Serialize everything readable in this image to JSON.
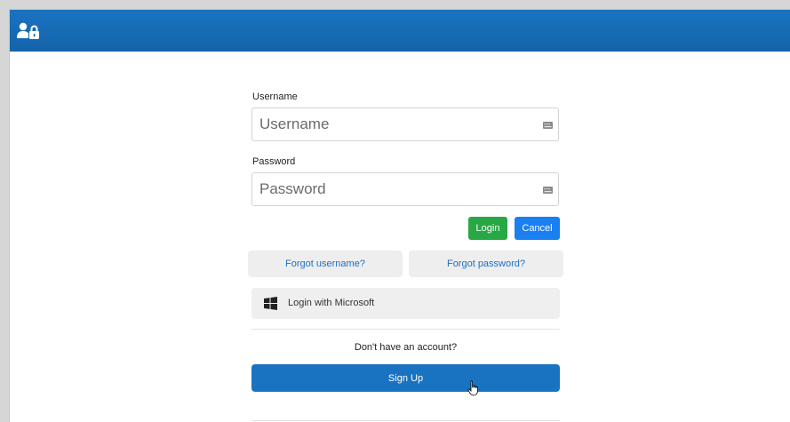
{
  "header": {
    "logo_icon": "user-lock-icon",
    "color": "#1a73c1"
  },
  "form": {
    "username_label": "Username",
    "username_placeholder": "Username",
    "username_value": "",
    "password_label": "Password",
    "password_placeholder": "Password",
    "password_value": "",
    "field_icon": "keyboard-icon",
    "login_label": "Login",
    "cancel_label": "Cancel",
    "forgot_username_label": "Forgot username?",
    "forgot_password_label": "Forgot password?",
    "microsoft_icon": "windows-icon",
    "microsoft_label": "Login with Microsoft",
    "no_account_text": "Don't have an account?",
    "signup_label": "Sign Up"
  },
  "colors": {
    "login_button": "#28a745",
    "cancel_button": "#1a7ff0",
    "signup_button": "#1a73c1",
    "link_text": "#1f6fc4",
    "secondary_button_bg": "#eeeeee"
  }
}
